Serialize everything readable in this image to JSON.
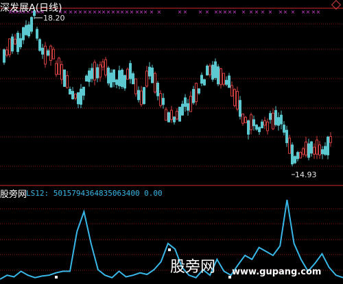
{
  "chart_title": "深发展A(日线)",
  "indicator_label": "股旁网",
  "indicator_value": "LS12: 5015794364835063400 0.00",
  "high_label": "18.20",
  "low_label": "14.93",
  "watermark": "股旁网",
  "watermark_url": "www.gupang.com",
  "colors": {
    "up": "#d04040",
    "down": "#5cc8d0",
    "grid": "#8b1a1a",
    "markers": "#d040d0",
    "indicator": "#38b8e8"
  },
  "chart_data": [
    {
      "type": "candlestick",
      "title": "深发展A(日线)",
      "ylim": [
        14.93,
        18.2
      ],
      "high": 18.2,
      "low": 14.93
    },
    {
      "type": "line",
      "title": "股旁网",
      "series": [
        {
          "name": "LS12",
          "values": [
            0,
            0.05,
            0.03,
            0.1,
            0.05,
            0.02,
            0.04,
            0.05,
            0.08,
            0.1,
            0.1,
            0.6,
            0.85,
            0.45,
            0.12,
            0.05,
            0.02,
            0.1,
            0.03,
            0.05,
            0.08,
            0.06,
            0.12,
            0.22,
            0.45,
            0.38,
            0.15,
            0.05,
            0.02,
            0.12,
            0.05,
            0.25,
            0.1,
            0.05,
            0.18,
            0.3,
            0.25,
            0.4,
            0.35,
            0.3,
            0.42,
            1.0,
            0.45,
            0.25,
            0.1,
            0.2,
            0.32,
            0.15,
            0.05,
            0.02
          ]
        }
      ]
    }
  ]
}
